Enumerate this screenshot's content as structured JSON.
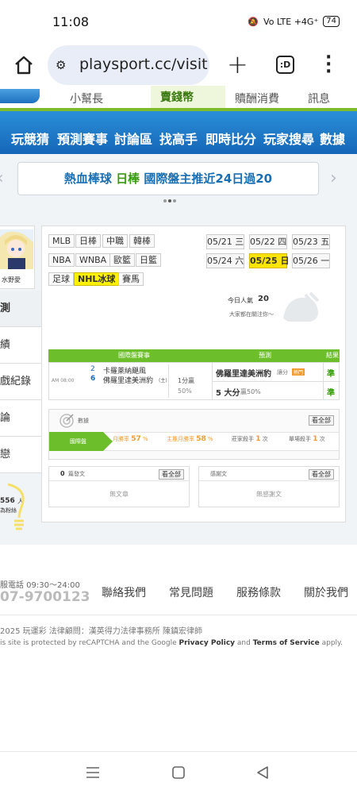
{
  "status_bar": {
    "time": "11:08",
    "signal": "Vo LTE +4G⁺",
    "battery": "74"
  },
  "browser": {
    "url": "playsport.cc/visit"
  },
  "site_top": {
    "link_1": "小幫長",
    "link_2": "賣錢幣",
    "link_3": "贖酬消費",
    "link_4": "訊息"
  },
  "nav": {
    "items": [
      "玩競猜",
      "預測賽事",
      "討論區",
      "找高手",
      "即時比分",
      "玩家搜尋",
      "數據"
    ]
  },
  "banner": {
    "part1": "熱血棒球",
    "part2": "日棒",
    "part3": "國際盤主推近24日過20"
  },
  "user": {
    "name": "水野愛"
  },
  "side_menu": [
    "測",
    "績",
    "戲紀錄",
    "論",
    "戀"
  ],
  "side_popularity": {
    "count": "556",
    "unit": "人",
    "note": "為粉絲"
  },
  "sports": {
    "row1": [
      "MLB",
      "日棒",
      "中職",
      "韓棒"
    ],
    "row2": [
      "NBA",
      "WNBA",
      "歐籃",
      "日籃"
    ],
    "row3": [
      "足球",
      "NHL冰球",
      "賽馬"
    ],
    "active": "NHL冰球"
  },
  "dates": {
    "row1": [
      "05/21 三",
      "05/22 四",
      "05/23 五"
    ],
    "row2": [
      "05/24 六",
      "05/25 日",
      "05/26 一"
    ],
    "active": "05/25 日"
  },
  "popularity": {
    "label": "今日人氣",
    "value": "20",
    "note": "大家都在關注你～"
  },
  "game_table": {
    "headers": [
      "國際盤賽事",
      "預測",
      "結果"
    ],
    "time": "AM 08:00",
    "team1_num": "2",
    "team1": "卡羅萊納颶風",
    "team2_num": "6",
    "team2": "佛羅里達美洲豹",
    "team2_tag": "(主)",
    "handicap": "1分贏",
    "handicap_pct": "50%",
    "pick1": "佛羅里達美洲豹",
    "pick1_note": "讓分",
    "pick1_badge": "熱門",
    "pick2": "5 大分",
    "pick2_note": "贏50%",
    "result1": "準",
    "result2": "準"
  },
  "stats": {
    "title": "數據",
    "all_btn": "看全部",
    "tab": "國際盤",
    "monthly_win": {
      "label": "月勝率",
      "value": "57",
      "unit": "%"
    },
    "main_win": {
      "label": "主推月勝率",
      "value": "58",
      "unit": "%"
    },
    "streak": {
      "label": "莊家殺手",
      "value": "1",
      "unit": "次"
    },
    "single": {
      "label": "單場殺手",
      "value": "1",
      "unit": "次"
    }
  },
  "posts": {
    "count": "0",
    "label": "篇發文",
    "empty": "無文章",
    "btn": "看全部"
  },
  "thanks": {
    "label": "感謝文",
    "empty": "無感謝文",
    "btn": "看全部"
  },
  "footer": {
    "hotline_label": "服電話 09:30～24:00",
    "hotline_number": "07-9700123",
    "links": [
      "聯絡我們",
      "常見問題",
      "服務條款",
      "關於我們"
    ],
    "copyright": "2025 玩運彩 法律顧問：漢英得力法律事務所 陳鎮宏律師",
    "captcha": "is site is protected by reCAPTCHA and the Google",
    "privacy": "Privacy Policy",
    "and": "and",
    "terms": "Terms of Service",
    "apply": "apply."
  },
  "colors": {
    "nav_blue": "#1e78c8",
    "brand_green": "#6cbf2a",
    "highlight_yellow": "#ffe400"
  }
}
